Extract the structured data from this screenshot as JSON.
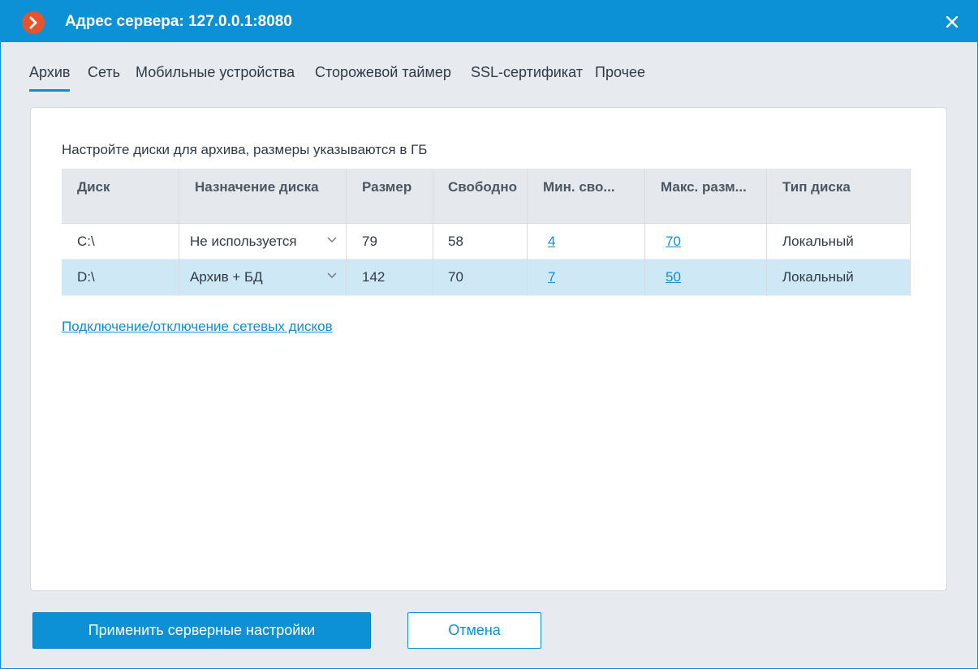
{
  "window": {
    "title": "Адрес сервера: 127.0.0.1:8080"
  },
  "tabs": [
    {
      "label": "Архив",
      "active": true
    },
    {
      "label": "Сеть",
      "active": false
    },
    {
      "label": "Мобильные устройства",
      "active": false
    },
    {
      "label": "Сторожевой таймер",
      "active": false
    },
    {
      "label": "SSL-сертификат",
      "active": false
    },
    {
      "label": "Прочее",
      "active": false
    }
  ],
  "archive": {
    "hint": "Настройте диски для архива, размеры указываются в ГБ",
    "columns": [
      "Диск",
      "Назначение диска",
      "Размер",
      "Свободно",
      "Мин. сво...",
      "Макс. разм...",
      "Тип диска"
    ],
    "rows": [
      {
        "disk": "C:\\",
        "purpose": "Не используется",
        "size": "79",
        "free": "58",
        "min_free": "4",
        "max_size": "70",
        "type": "Локальный",
        "selected": false
      },
      {
        "disk": "D:\\",
        "purpose": "Архив + БД",
        "size": "142",
        "free": "70",
        "min_free": "7",
        "max_size": "50",
        "type": "Локальный",
        "selected": true
      }
    ],
    "network_link": "Подключение/отключение сетевых дисков"
  },
  "buttons": {
    "apply": "Применить серверные настройки",
    "cancel": "Отмена"
  },
  "colors": {
    "accent": "#0c91d7",
    "logo": "#e8532b",
    "selected_row": "#cfe8f5"
  }
}
